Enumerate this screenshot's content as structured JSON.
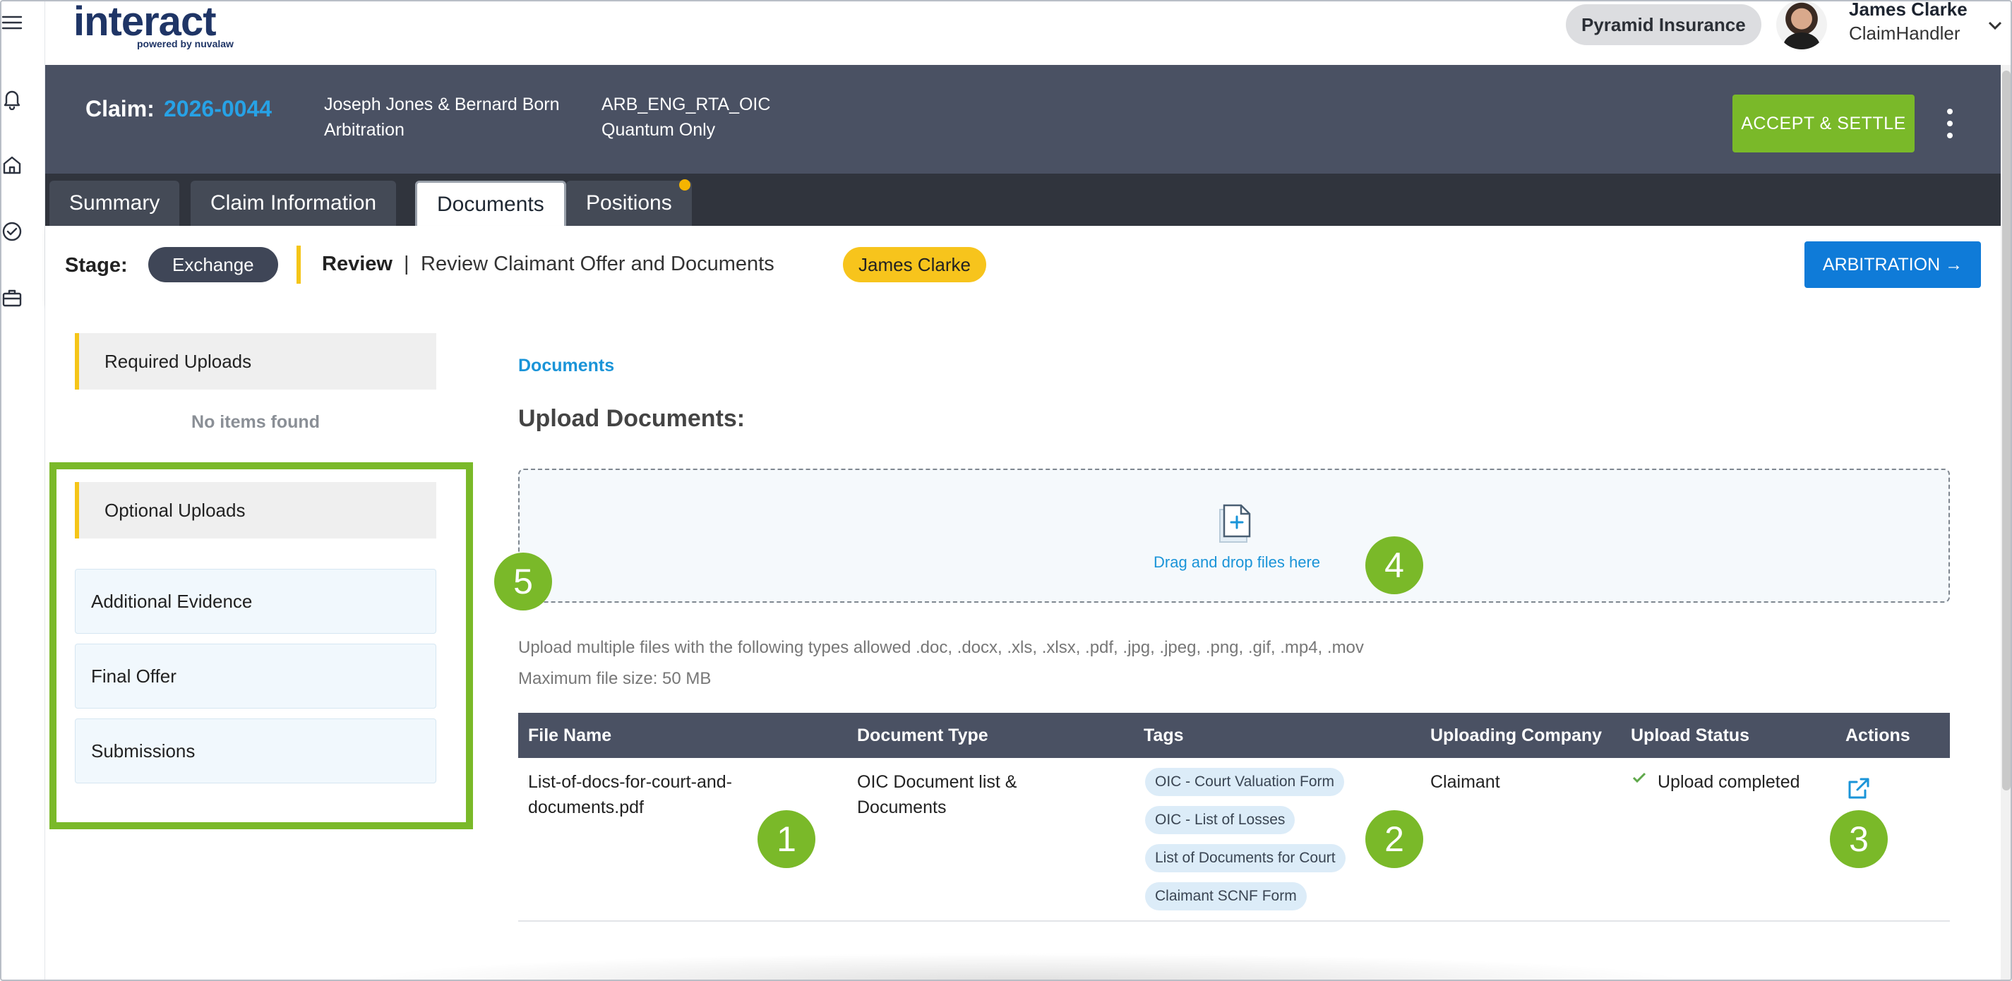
{
  "brand": {
    "logo_text": "interact",
    "logo_tagline": "powered by nuvalaw",
    "accent_green": "#7ab929",
    "accent_blue": "#1a94d8",
    "accent_yellow": "#f5c518",
    "dark_slate": "#4a5163"
  },
  "rail": {
    "icons": [
      "menu-icon",
      "bell-icon",
      "home-icon",
      "check-circle-icon",
      "briefcase-icon"
    ]
  },
  "header": {
    "company": "Pyramid Insurance",
    "user_name": "James Clarke",
    "user_role": "ClaimHandler"
  },
  "claim": {
    "label": "Claim:",
    "number": "2026-0044",
    "parties": "Joseph Jones & Bernard Born",
    "process": "Arbitration",
    "ref_code": "ARB_ENG_RTA_OIC",
    "scope": "Quantum Only",
    "accept_label": "ACCEPT & SETTLE"
  },
  "tabs": [
    {
      "label": "Summary"
    },
    {
      "label": "Claim Information"
    },
    {
      "label": "Documents"
    },
    {
      "label": "Positions"
    }
  ],
  "stage": {
    "label": "Stage:",
    "value": "Exchange",
    "step": "Review",
    "separator": "|",
    "description": "Review Claimant Offer and Documents",
    "assignee": "James Clarke",
    "next_label": "ARBITRATION →"
  },
  "sidebar": {
    "required_heading": "Required Uploads",
    "required_empty": "No items found",
    "optional_heading": "Optional Uploads",
    "optional_items": [
      "Additional Evidence",
      "Final Offer",
      "Submissions"
    ]
  },
  "content": {
    "breadcrumb": "Documents",
    "heading": "Upload Documents:",
    "dropzone_text": "Drag and drop files here",
    "allowed_types": "Upload multiple files with the following types allowed .doc, .docx, .xls, .xlsx, .pdf, .jpg, .jpeg, .png, .gif, .mp4, .mov",
    "max_size": "Maximum file size: 50 MB"
  },
  "table": {
    "headers": [
      "File Name",
      "Document Type",
      "Tags",
      "Uploading Company",
      "Upload Status",
      "Actions"
    ],
    "rows": [
      {
        "file_name_line1": "List-of-docs-for-court-and-",
        "file_name_line2": "documents.pdf",
        "doc_type_line1": "OIC Document list &",
        "doc_type_line2": "Documents",
        "tags": [
          "OIC - Court Valuation Form",
          "OIC - List of Losses",
          "List of Documents for Court",
          "Claimant SCNF Form"
        ],
        "company": "Claimant",
        "status": "Upload completed"
      }
    ]
  },
  "callouts": [
    "1",
    "2",
    "3",
    "4",
    "5"
  ]
}
